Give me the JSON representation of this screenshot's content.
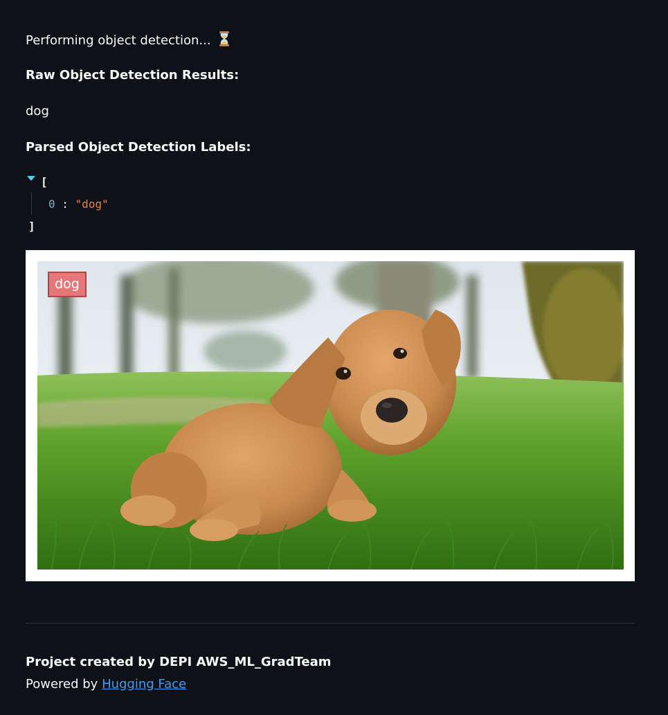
{
  "status": {
    "text": "Performing object detection...",
    "icon": "hourglass-icon"
  },
  "raw_results": {
    "heading": "Raw Object Detection Results:",
    "value": "dog"
  },
  "parsed_labels": {
    "heading": "Parsed Object Detection Labels:",
    "open_bracket": "[",
    "close_bracket": "]",
    "items": [
      {
        "index": "0",
        "value": "\"dog\""
      }
    ]
  },
  "detection_image": {
    "label": "dog",
    "label_color": "#e5767a"
  },
  "footer": {
    "credits": "Project created by DEPI AWS_ML_GradTeam",
    "powered_prefix": "Powered by",
    "powered_link": "Hugging Face"
  },
  "colors": {
    "background": "#0e1117",
    "text": "#fafafa",
    "link": "#3d9df3",
    "json_string": "#f0833a",
    "json_key": "#7fb0c8",
    "caret": "#4fd1e8"
  }
}
